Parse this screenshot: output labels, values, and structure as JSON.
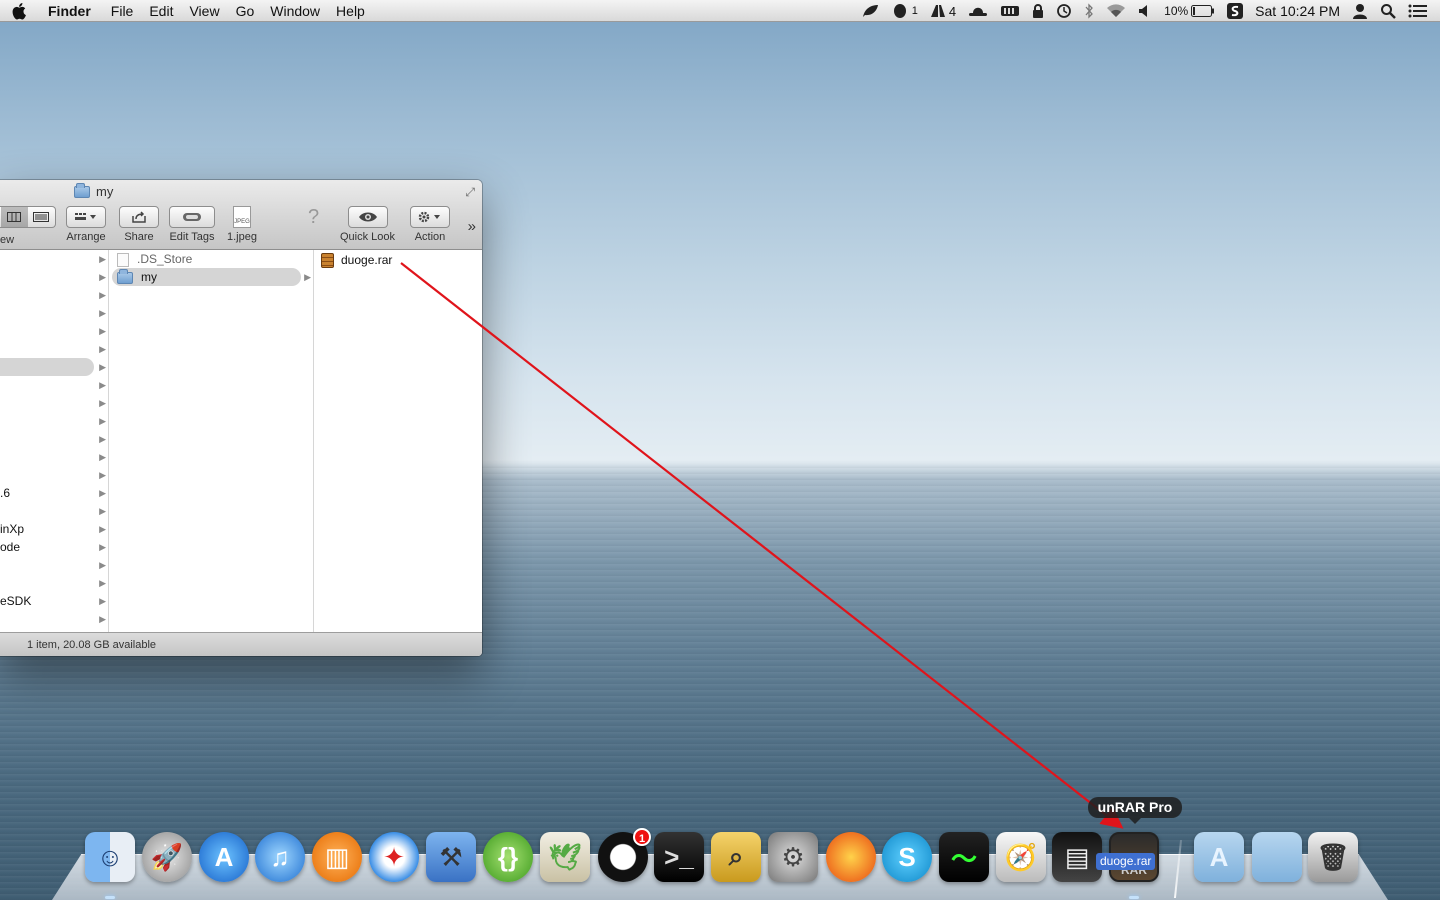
{
  "menubar": {
    "app_name": "Finder",
    "menus": [
      "File",
      "Edit",
      "View",
      "Go",
      "Window",
      "Help"
    ],
    "status": {
      "qq_count": "1",
      "adobe_count": "4",
      "battery": "10%",
      "clock": "Sat 10:24 PM"
    }
  },
  "finder": {
    "title": "my",
    "toolbar": {
      "view_label": "ew",
      "arrange_label": "Arrange",
      "share_label": "Share",
      "edit_tags_label": "Edit Tags",
      "file_label": "1.jpeg",
      "quick_look_label": "Quick Look",
      "action_label": "Action"
    },
    "column1": {
      "rows": [
        "",
        "",
        "",
        "",
        "",
        "",
        "",
        "",
        "",
        "",
        "",
        "",
        "",
        ".6",
        "",
        "inXp",
        "ode",
        "",
        "",
        "eSDK",
        ""
      ]
    },
    "column2": {
      "items": [
        ".DS_Store",
        "my"
      ]
    },
    "column3": {
      "items": [
        "duoge.rar"
      ]
    },
    "status_text": "1 item, 20.08 GB available"
  },
  "dock": {
    "tooltip": "unRAR Pro",
    "drag_label": "duoge.rar",
    "unrar_icon_text": "RAR",
    "qq_badge": "1",
    "items": [
      "finder-icon",
      "launchpad-icon",
      "app-store-icon",
      "itunes-icon",
      "ibooks-icon",
      "safari-icon",
      "xcode-icon",
      "brackets-icon",
      "mail-icon",
      "qq-icon",
      "terminal-icon",
      "preview-icon",
      "system-preferences-icon",
      "firefox-icon",
      "sublime-icon",
      "activity-monitor-icon",
      "directory-utility-icon",
      "stats-icon",
      "unrar-pro-icon",
      "applications-folder-icon",
      "documents-folder-icon",
      "trash-icon"
    ]
  }
}
